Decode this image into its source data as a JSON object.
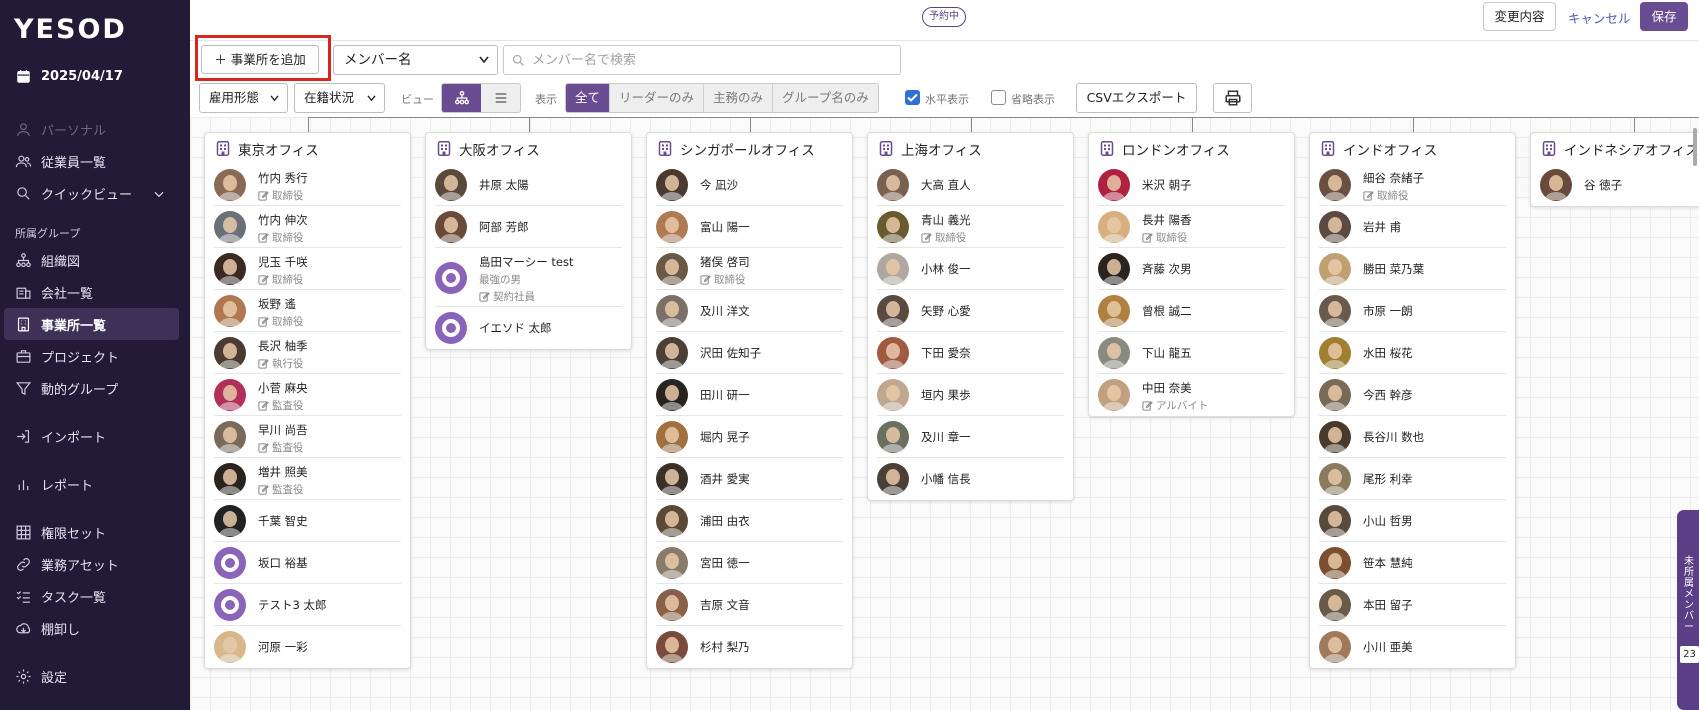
{
  "brand": {
    "logo": "YESOD"
  },
  "sidebar": {
    "date": "2025/04/17",
    "personal": "パーソナル",
    "employees": "従業員一覧",
    "quickview": "クイックビュー",
    "section_label": "所属グループ",
    "groups": [
      {
        "label": "組織図",
        "icon": "org-chart-icon"
      },
      {
        "label": "会社一覧",
        "icon": "company-icon"
      },
      {
        "label": "事業所一覧",
        "icon": "building-icon",
        "active": true
      },
      {
        "label": "プロジェクト",
        "icon": "briefcase-icon"
      },
      {
        "label": "動的グループ",
        "icon": "filter-icon"
      }
    ],
    "import": "インポート",
    "report": "レポート",
    "tools": [
      {
        "label": "権限セット",
        "icon": "grid-icon"
      },
      {
        "label": "業務アセット",
        "icon": "link-icon"
      },
      {
        "label": "タスク一覧",
        "icon": "task-list-icon"
      },
      {
        "label": "棚卸し",
        "icon": "inventory-icon"
      }
    ],
    "settings": "設定"
  },
  "topbar": {
    "status_badge": "予約中",
    "changes_label": "変更内容",
    "cancel_label": "キャンセル",
    "save_label": "保存"
  },
  "toolbar": {
    "add_office_label": "事業所を追加",
    "member_select_value": "メンバー名",
    "search_placeholder": "メンバー名で検索",
    "employment_type_label": "雇用形態",
    "status_label": "在籍状況",
    "view_label": "ビュー",
    "display_label": "表示",
    "display_options": [
      "全て",
      "リーダーのみ",
      "主務のみ",
      "グループ名のみ"
    ],
    "display_selected": "全て",
    "horizontal_label": "水平表示",
    "horizontal_checked": true,
    "abbrev_label": "省略表示",
    "abbrev_checked": false,
    "csv_label": "CSVエクスポート"
  },
  "offices": [
    {
      "name": "東京オフィス",
      "members": [
        {
          "name": "竹内 秀行",
          "role": "取締役",
          "avatar": "#8a6a55"
        },
        {
          "name": "竹内 伸次",
          "role": "取締役",
          "avatar": "#6a7078"
        },
        {
          "name": "児玉 千咲",
          "role": "取締役",
          "avatar": "#3b2a22"
        },
        {
          "name": "坂野 遙",
          "role": "取締役",
          "avatar": "#b07850"
        },
        {
          "name": "長沢 柚季",
          "role": "執行役",
          "avatar": "#4a3a30"
        },
        {
          "name": "小菅 麻央",
          "role": "監査役",
          "avatar": "#b0305a"
        },
        {
          "name": "早川 尚吾",
          "role": "監査役",
          "avatar": "#7a6a5a"
        },
        {
          "name": "増井 照美",
          "role": "監査役",
          "avatar": "#2a2420"
        },
        {
          "name": "千葉 智史",
          "role": "",
          "avatar": "#222222"
        },
        {
          "name": "坂口 裕基",
          "role": "",
          "avatar": "default"
        },
        {
          "name": "テスト3 太郎",
          "role": "",
          "avatar": "default"
        },
        {
          "name": "河原 一彩",
          "role": "",
          "avatar": "#d8b88a"
        }
      ]
    },
    {
      "name": "大阪オフィス",
      "members": [
        {
          "name": "井原 太陽",
          "role": "",
          "avatar": "#5a4a3a"
        },
        {
          "name": "阿部 芳郎",
          "role": "",
          "avatar": "#6a4a3a"
        },
        {
          "name": "島田マーシー test",
          "sub": "最強の男",
          "role": "契約社員",
          "avatar": "default"
        },
        {
          "name": "イエソド 太郎",
          "role": "",
          "avatar": "default"
        }
      ]
    },
    {
      "name": "シンガポールオフィス",
      "members": [
        {
          "name": "今 凪沙",
          "role": "",
          "avatar": "#4a3a30"
        },
        {
          "name": "富山 陽一",
          "role": "",
          "avatar": "#b07a55"
        },
        {
          "name": "猪俣 啓司",
          "role": "取締役",
          "avatar": "#6a5a45"
        },
        {
          "name": "及川 洋文",
          "role": "",
          "avatar": "#7a7068"
        },
        {
          "name": "沢田 佐知子",
          "role": "",
          "avatar": "#4a4038"
        },
        {
          "name": "田川 研一",
          "role": "",
          "avatar": "#2a2420"
        },
        {
          "name": "堀内 晃子",
          "role": "",
          "avatar": "#a07040"
        },
        {
          "name": "酒井 愛実",
          "role": "",
          "avatar": "#3a302a"
        },
        {
          "name": "浦田 由衣",
          "role": "",
          "avatar": "#5a4a35"
        },
        {
          "name": "宮田 徳一",
          "role": "",
          "avatar": "#8a7a6a"
        },
        {
          "name": "吉原 文音",
          "role": "",
          "avatar": "#8a6048"
        },
        {
          "name": "杉村 梨乃",
          "role": "",
          "avatar": "#7a4a3a"
        }
      ]
    },
    {
      "name": "上海オフィス",
      "members": [
        {
          "name": "大高 直人",
          "role": "",
          "avatar": "#7a6050"
        },
        {
          "name": "青山 義光",
          "role": "取締役",
          "avatar": "#6a5a30"
        },
        {
          "name": "小林 俊一",
          "role": "",
          "avatar": "#b0a8a0"
        },
        {
          "name": "矢野 心愛",
          "role": "",
          "avatar": "#5a4a40"
        },
        {
          "name": "下田 愛奈",
          "role": "",
          "avatar": "#a05a40"
        },
        {
          "name": "垣内 果歩",
          "role": "",
          "avatar": "#c0a890"
        },
        {
          "name": "及川 章一",
          "role": "",
          "avatar": "#6a7060"
        },
        {
          "name": "小幡 信長",
          "role": "",
          "avatar": "#4a4038"
        }
      ]
    },
    {
      "name": "ロンドンオフィス",
      "members": [
        {
          "name": "米沢 朝子",
          "role": "",
          "avatar": "#b02040"
        },
        {
          "name": "長井 陽香",
          "role": "取締役",
          "avatar": "#d8b080"
        },
        {
          "name": "斉藤 次男",
          "role": "",
          "avatar": "#2a2420"
        },
        {
          "name": "曾根 誠二",
          "role": "",
          "avatar": "#b08040"
        },
        {
          "name": "下山 龍五",
          "role": "",
          "avatar": "#8a8a80"
        },
        {
          "name": "中田 奈美",
          "role": "アルバイト",
          "avatar": "#c0a080"
        }
      ]
    },
    {
      "name": "インドオフィス",
      "members": [
        {
          "name": "細谷 奈緒子",
          "role": "取締役",
          "avatar": "#6a5040"
        },
        {
          "name": "岩井 甫",
          "role": "",
          "avatar": "#5a4a40"
        },
        {
          "name": "勝田 菜乃葉",
          "role": "",
          "avatar": "#c0a070"
        },
        {
          "name": "市原 一朗",
          "role": "",
          "avatar": "#6a5a4a"
        },
        {
          "name": "水田 桜花",
          "role": "",
          "avatar": "#a08030"
        },
        {
          "name": "今西 幹彦",
          "role": "",
          "avatar": "#7a6a55"
        },
        {
          "name": "長谷川 数也",
          "role": "",
          "avatar": "#4a3a2a"
        },
        {
          "name": "尾形 利幸",
          "role": "",
          "avatar": "#8a7a60"
        },
        {
          "name": "小山 哲男",
          "role": "",
          "avatar": "#5a4a3a"
        },
        {
          "name": "笹本 慧純",
          "role": "",
          "avatar": "#7a5030"
        },
        {
          "name": "本田 留子",
          "role": "",
          "avatar": "#6a5a48"
        },
        {
          "name": "小川 亜美",
          "role": "",
          "avatar": "#a07a5a"
        }
      ]
    },
    {
      "name": "インドネシアオフィス",
      "members": [
        {
          "name": "谷 徳子",
          "role": "",
          "avatar": "#6a4a3a"
        }
      ]
    }
  ],
  "floating_panel": {
    "label": "未所属メンバー",
    "count": "23"
  }
}
